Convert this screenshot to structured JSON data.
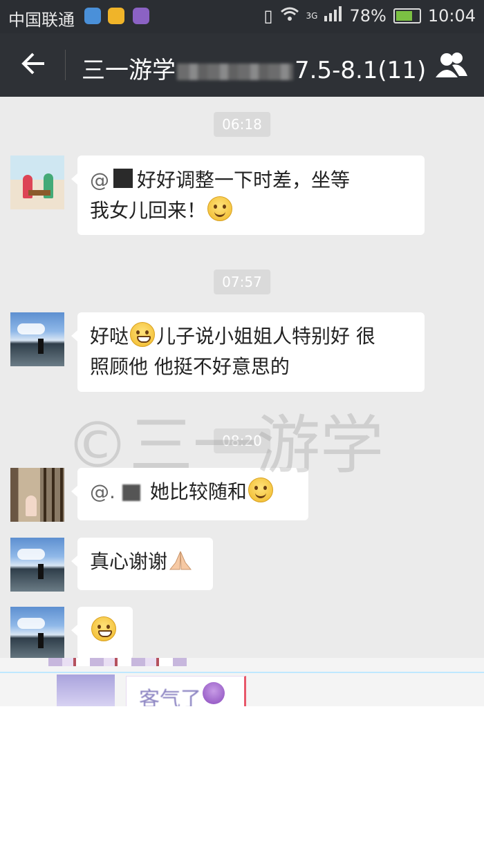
{
  "status_bar": {
    "carrier": "中国联通",
    "network": "3G",
    "battery": "78%",
    "battery_level": 0.78,
    "time": "10:04"
  },
  "header": {
    "title_prefix": "三一游学",
    "title_suffix": "7.5-8.1(11)"
  },
  "timestamps": [
    "06:18",
    "07:57",
    "08:20"
  ],
  "messages": [
    {
      "mention": "@",
      "text": "好好调整一下时差，坐等",
      "text2": "我女儿回来！",
      "emoji": "smile-emoji"
    },
    {
      "text": "好哒",
      "emoji": "grin-emoji",
      "text2": "儿子说小姐姐人特别好 很",
      "text3": "照顾他 他挺不好意思的"
    },
    {
      "mention": "@.",
      "text": "她比较随和",
      "emoji": "blush-emoji"
    },
    {
      "text": "真心谢谢",
      "emoji": "praying-hands-emoji"
    },
    {
      "emoji": "grin-emoji"
    }
  ],
  "watermark": "©三一游学",
  "glitch_text": "客气了"
}
